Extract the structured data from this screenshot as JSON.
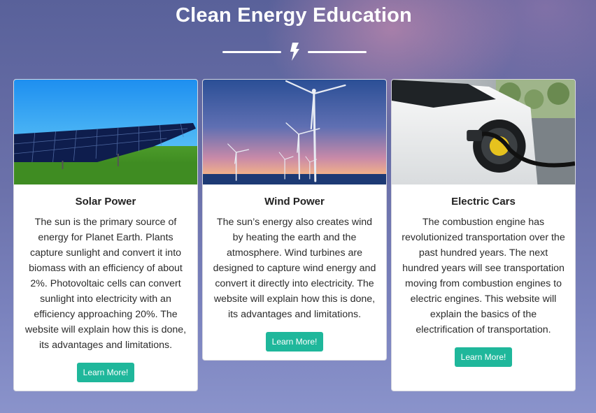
{
  "header": {
    "title": "Clean Energy Education",
    "divider_icon": "lightning-bolt-icon"
  },
  "colors": {
    "accent": "#1fb79b",
    "title_text": "#ffffff"
  },
  "cards": [
    {
      "title": "Solar Power",
      "image": "solar-panel-image",
      "text": "The sun is the primary source of energy for Planet Earth. Plants capture sunlight and convert it into biomass with an efficiency of about 2%. Photovoltaic cells can convert sunlight into electricity with an efficiency approaching 20%. The website will explain how this is done, its advantages and limitations.",
      "button": "Learn More!"
    },
    {
      "title": "Wind Power",
      "image": "wind-turbines-image",
      "text": "The sun’s energy also creates wind by heating the earth and the atmosphere. Wind turbines are designed to capture wind energy and convert it directly into electricity. The website will explain how this is done, its advantages and limitations.",
      "button": "Learn More!"
    },
    {
      "title": "Electric Cars",
      "image": "electric-car-charging-image",
      "text": "The combustion engine has revolutionized transportation over the past hundred years. The next hundred years will see transportation moving from combustion engines to electric engines. This website will explain the basics of the electrification of transportation.",
      "button": "Learn More!"
    }
  ]
}
